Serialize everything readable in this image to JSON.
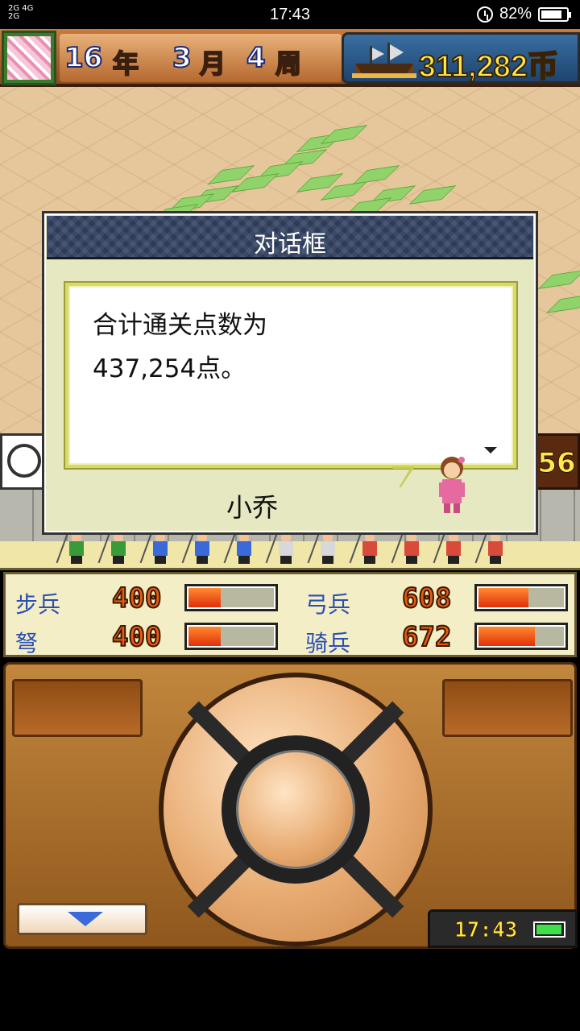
{
  "status_bar": {
    "network_top": "2G 4G",
    "network_bottom": "2G",
    "time": "17:43",
    "battery_percent": "82%",
    "battery_level": 0.82
  },
  "top_bar": {
    "year_num": "16",
    "year_unit": "年",
    "month_num": "3",
    "month_unit": "月",
    "week_num": "4",
    "week_unit": "周",
    "money": "311,282币",
    "ship_icon": "ship-icon",
    "portrait_icon": "cherry-blossom-icon"
  },
  "dialog": {
    "title": "对话框",
    "message": "合计通关点数为\n437,254点。",
    "speaker": "小乔"
  },
  "banner": {
    "right_value": "56"
  },
  "stats": {
    "infantry": {
      "label": "步兵",
      "value": "400",
      "level": 0.4
    },
    "archer": {
      "label": "弓兵",
      "value": "608",
      "level": 0.6
    },
    "crossbow": {
      "label": "弩",
      "value": "400",
      "level": 0.4
    },
    "cavalry": {
      "label": "骑兵",
      "value": "672",
      "level": 0.67
    }
  },
  "controller": {
    "game_clock": "17:43",
    "game_battery_level": 0.9
  },
  "colors": {
    "stat_label": "#2a4fb3",
    "money": "#ffe94a",
    "dialog_header": "#2c3b5a"
  }
}
